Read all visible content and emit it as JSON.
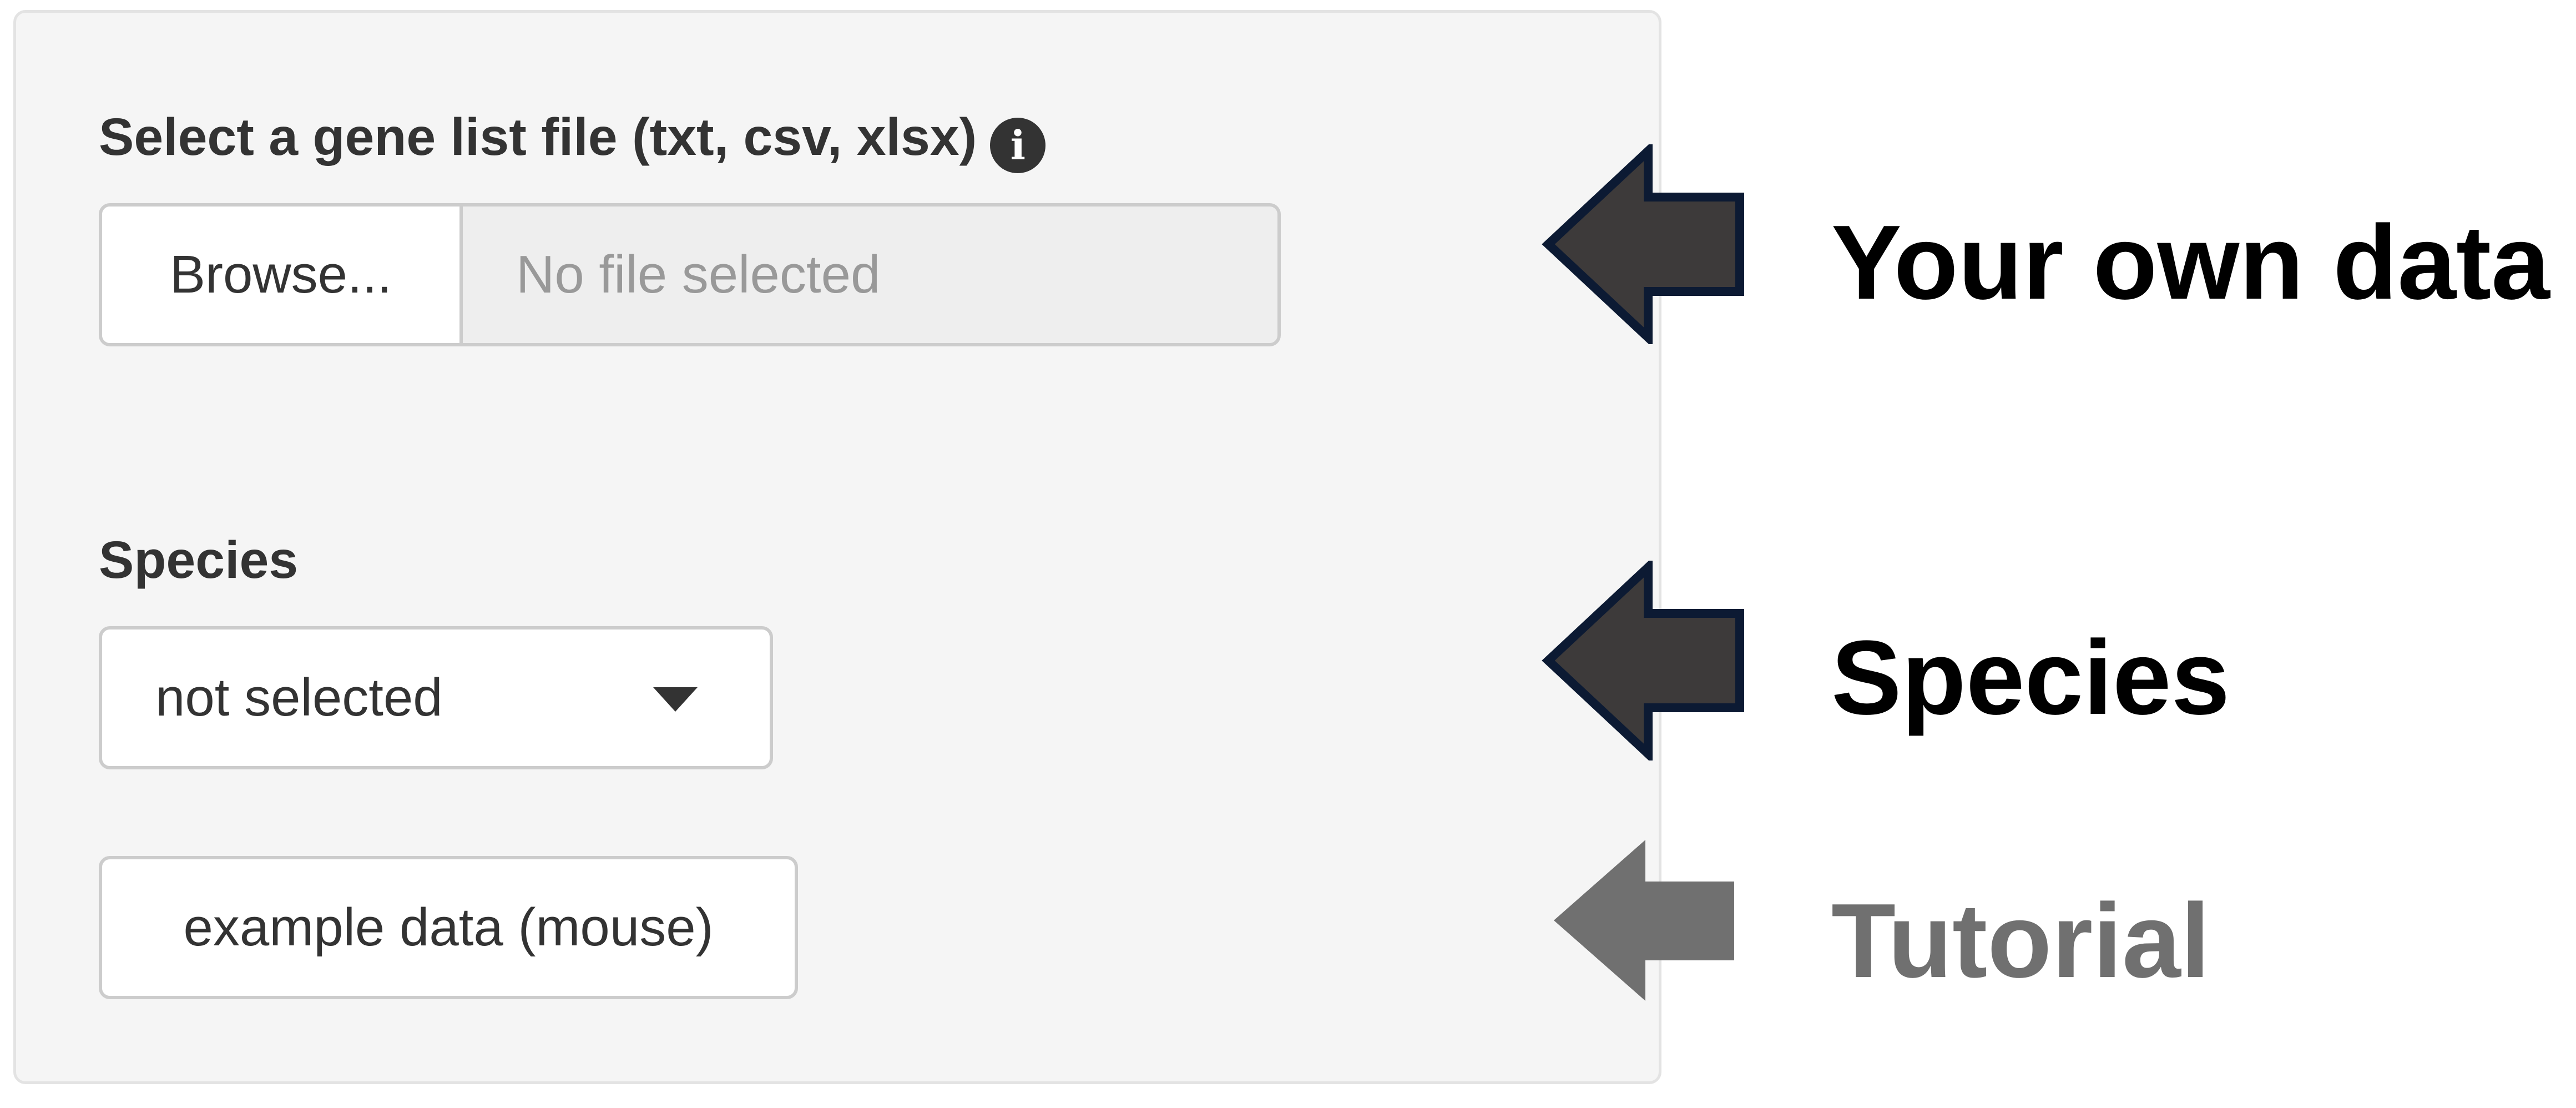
{
  "form": {
    "file_label": "Select a gene list file (txt, csv, xlsx)",
    "info_icon_glyph": "i",
    "browse_label": "Browse...",
    "file_placeholder": "No file selected",
    "species_label": "Species",
    "species_selected": "not selected",
    "example_button_label": "example data (mouse)"
  },
  "annotations": {
    "own_data": "Your own data",
    "species": "Species",
    "tutorial": "Tutorial"
  },
  "icons": {
    "info": "info-circle-icon",
    "caret": "caret-down-icon",
    "arrow": "arrow-left-icon"
  },
  "colors": {
    "panel_bg": "#f5f5f5",
    "panel_border": "#e3e3e3",
    "input_border": "#cccccc",
    "text": "#333333",
    "placeholder": "#999999",
    "arrow_dark_fill": "#3d3a3a",
    "arrow_dark_stroke": "#0c1a33",
    "arrow_gray": "#707070",
    "annotation_dark": "#000000",
    "annotation_gray": "#707070"
  }
}
